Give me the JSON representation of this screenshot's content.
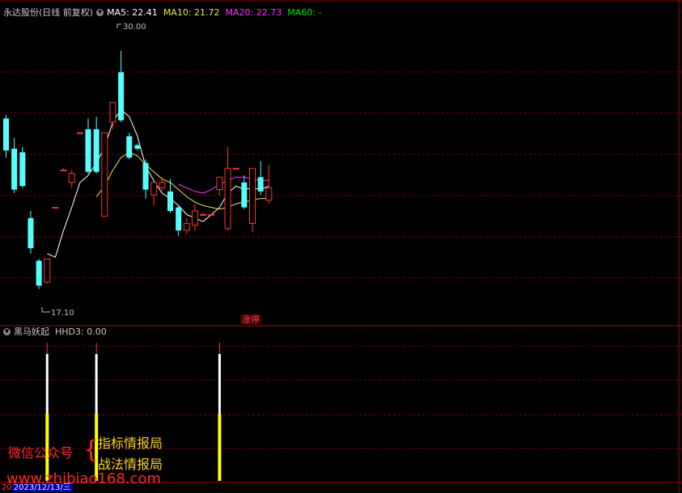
{
  "stock": {
    "name": "永达股份",
    "period": "(日线 前复权)",
    "ma5": "MA5: 22.41",
    "ma10": "MA10: 21.72",
    "ma20": "MA20: 22.73",
    "ma60": "MA60: -"
  },
  "colors": {
    "up": "#ff3232",
    "down": "#54ffff",
    "ma5": "#ffffff",
    "ma10": "#e6e650",
    "ma20": "#ff32ff",
    "ma60": "#00e600",
    "grid": "#7a0000"
  },
  "annotations": {
    "high_label": "30.00",
    "low_label": "17.10",
    "limit_up_badge": "涨停"
  },
  "indicator": {
    "name": "黑马妖起",
    "value": "HHD3: 0.00"
  },
  "watermark": {
    "left": "微信公众号",
    "brace": "{",
    "line1": "指标情报局",
    "line2": "战法情报局",
    "url": "www.zhibiao168.com"
  },
  "date": {
    "prefix": "20",
    "value": "2023/12/13/三"
  },
  "chart_data": {
    "type": "candlestick",
    "ylim": [
      15.5,
      31.5
    ],
    "candles": [
      {
        "o": 26.2,
        "c": 24.4,
        "h": 26.4,
        "l": 24.0
      },
      {
        "o": 24.5,
        "c": 22.2,
        "h": 25.1,
        "l": 22.0
      },
      {
        "o": 24.3,
        "c": 22.4,
        "h": 24.6,
        "l": 22.3
      },
      {
        "o": 20.6,
        "c": 18.9,
        "h": 21.0,
        "l": 18.6
      },
      {
        "o": 18.2,
        "c": 16.8,
        "h": 18.3,
        "l": 16.6
      },
      {
        "o": 17.0,
        "c": 18.3,
        "h": 18.3,
        "l": 16.9
      },
      {
        "o": 21.2,
        "c": 21.2,
        "h": 21.2,
        "l": 21.2
      },
      {
        "o": 23.3,
        "c": 23.3,
        "h": 23.4,
        "l": 23.3
      },
      {
        "o": 22.6,
        "c": 23.1,
        "h": 23.3,
        "l": 22.3
      },
      {
        "o": 25.4,
        "c": 25.4,
        "h": 25.4,
        "l": 25.4
      },
      {
        "o": 25.6,
        "c": 23.2,
        "h": 26.2,
        "l": 23.1
      },
      {
        "o": 25.6,
        "c": 23.2,
        "h": 26.3,
        "l": 23.1
      },
      {
        "o": 20.7,
        "c": 25.4,
        "h": 25.4,
        "l": 20.7
      },
      {
        "o": 26.0,
        "c": 27.1,
        "h": 27.1,
        "l": 25.6
      },
      {
        "o": 28.8,
        "c": 26.1,
        "h": 30.0,
        "l": 26.0
      },
      {
        "o": 25.2,
        "c": 24.0,
        "h": 25.4,
        "l": 23.9
      },
      {
        "o": 24.7,
        "c": 24.5,
        "h": 24.8,
        "l": 24.4
      },
      {
        "o": 23.7,
        "c": 22.2,
        "h": 23.9,
        "l": 21.7
      },
      {
        "o": 21.9,
        "c": 22.6,
        "h": 22.6,
        "l": 21.3
      },
      {
        "o": 22.3,
        "c": 22.6,
        "h": 22.9,
        "l": 22.1
      },
      {
        "o": 22.1,
        "c": 21.0,
        "h": 22.8,
        "l": 20.9
      },
      {
        "o": 21.2,
        "c": 19.9,
        "h": 21.3,
        "l": 19.6
      },
      {
        "o": 19.9,
        "c": 20.3,
        "h": 20.6,
        "l": 19.7
      },
      {
        "o": 20.2,
        "c": 21.0,
        "h": 21.4,
        "l": 19.9
      },
      {
        "o": 20.8,
        "c": 20.8,
        "h": 20.9,
        "l": 20.7
      },
      {
        "o": 20.8,
        "c": 20.8,
        "h": 20.8,
        "l": 20.8
      },
      {
        "o": 22.2,
        "c": 22.9,
        "h": 22.9,
        "l": 21.9
      },
      {
        "o": 20.0,
        "c": 23.4,
        "h": 24.6,
        "l": 19.9
      },
      {
        "o": 23.4,
        "c": 23.4,
        "h": 23.4,
        "l": 23.4
      },
      {
        "o": 22.6,
        "c": 21.2,
        "h": 23.0,
        "l": 21.1
      },
      {
        "o": 20.3,
        "c": 23.4,
        "h": 23.4,
        "l": 19.8
      },
      {
        "o": 22.9,
        "c": 22.1,
        "h": 23.8,
        "l": 21.9
      },
      {
        "o": 21.6,
        "c": 22.3,
        "h": 23.6,
        "l": 21.4
      }
    ],
    "ma5": [
      null,
      null,
      null,
      null,
      null,
      18.6,
      18.4,
      19.9,
      21.2,
      22.6,
      23.0,
      23.7,
      24.6,
      26.0,
      26.7,
      26.3,
      25.2,
      23.5,
      22.7,
      22.0,
      21.7,
      21.3,
      20.8,
      20.6,
      20.4,
      20.8,
      21.2,
      22.0,
      22.4,
      22.2,
      22.3,
      22.2,
      22.4
    ],
    "ma10": [
      null,
      null,
      null,
      null,
      null,
      null,
      null,
      null,
      null,
      null,
      null,
      21.8,
      22.4,
      23.3,
      24.0,
      24.3,
      24.1,
      23.6,
      23.2,
      22.8,
      22.6,
      22.2,
      21.8,
      21.5,
      21.3,
      21.2,
      21.1,
      21.2,
      21.4,
      21.5,
      21.6,
      21.7,
      21.7
    ],
    "ma20": [
      null,
      null,
      null,
      null,
      null,
      null,
      null,
      null,
      null,
      null,
      null,
      null,
      null,
      null,
      null,
      null,
      null,
      null,
      null,
      null,
      null,
      22.5,
      22.3,
      22.1,
      22.0,
      22.2,
      22.5,
      22.7,
      22.9,
      22.9,
      22.8,
      22.7,
      22.73
    ],
    "indicator_signals": [
      {
        "index": 5,
        "value": 1
      },
      {
        "index": 11,
        "value": 1
      },
      {
        "index": 26,
        "value": 1
      }
    ]
  }
}
